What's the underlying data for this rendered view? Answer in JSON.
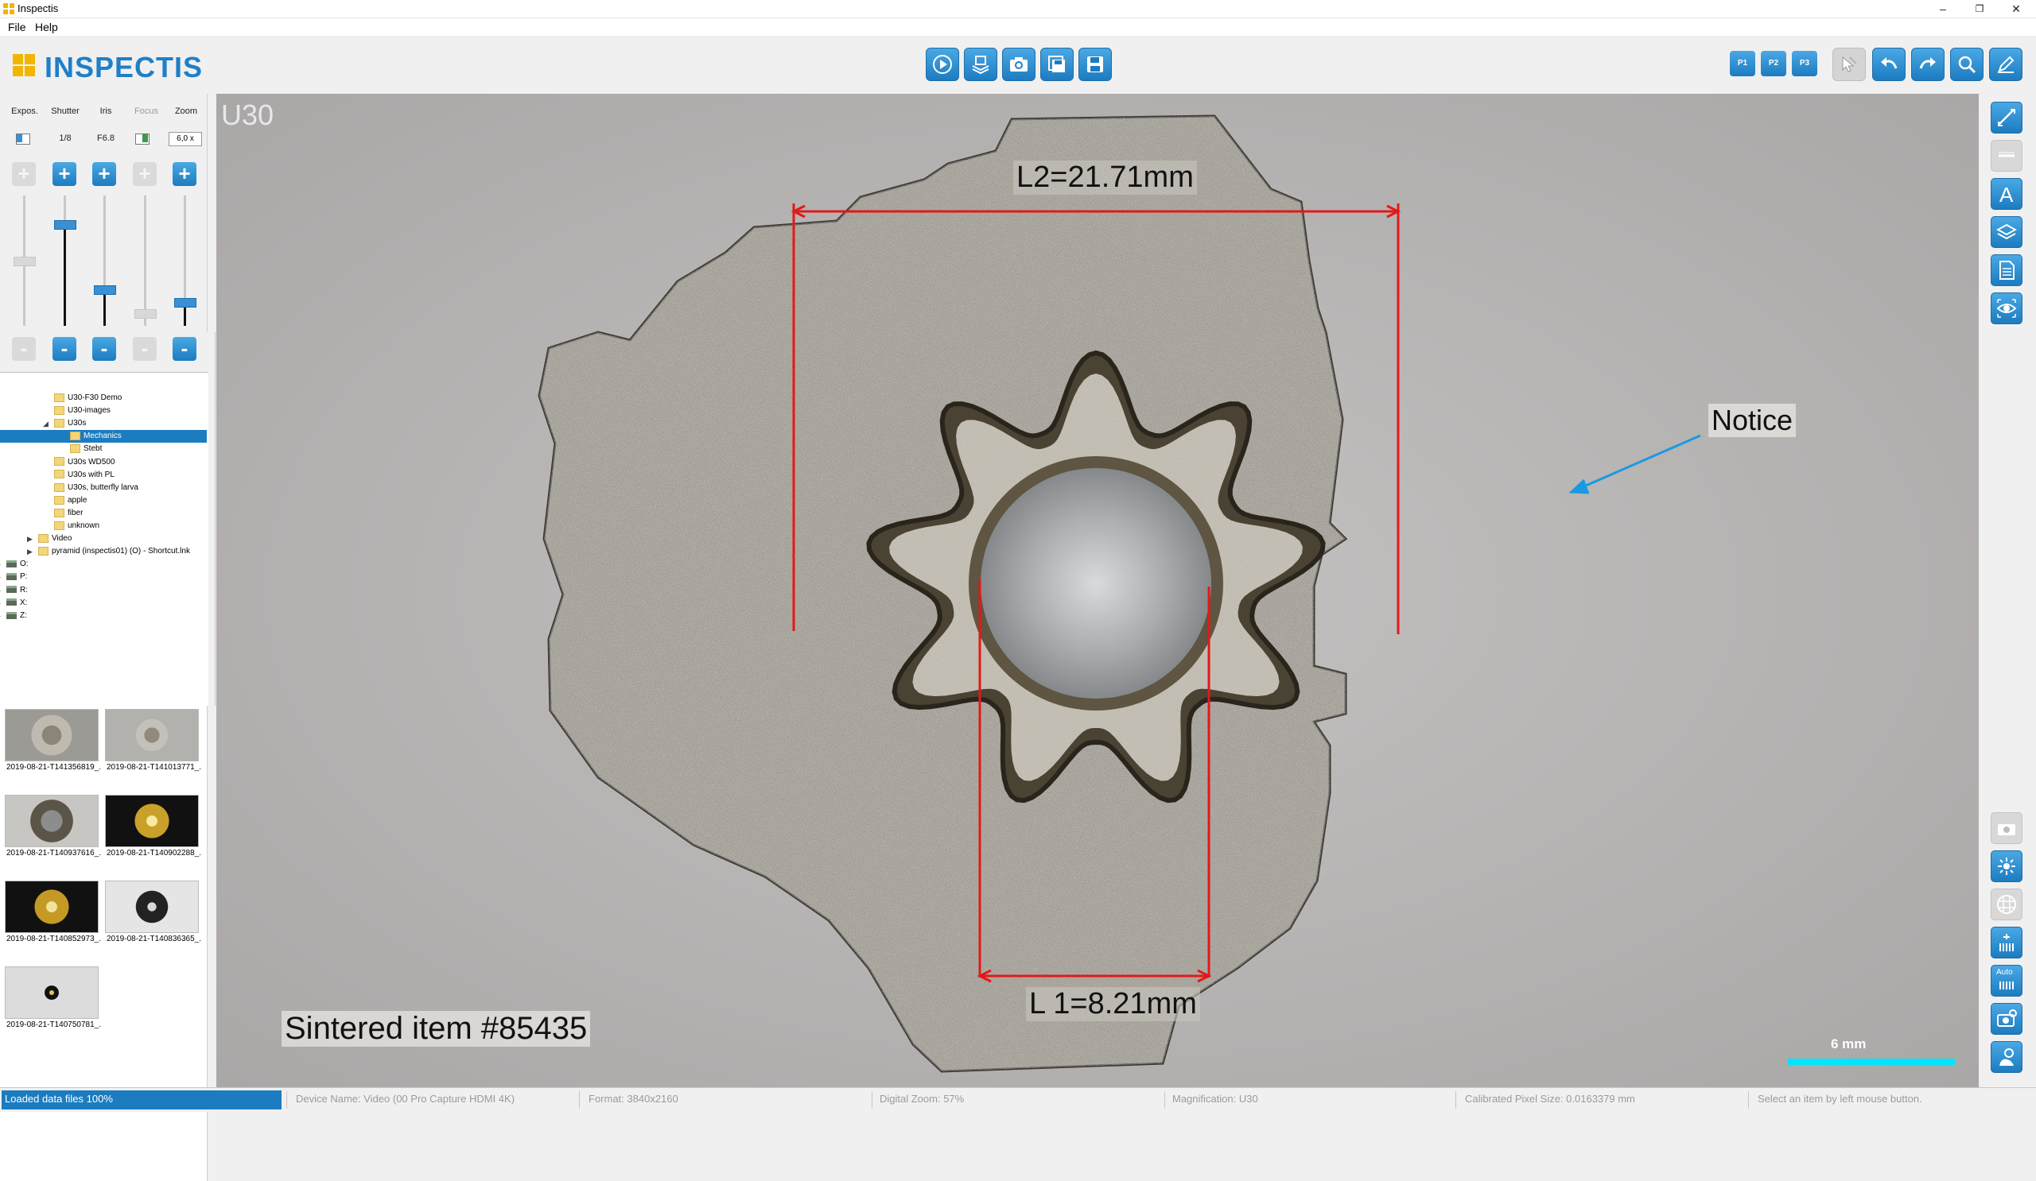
{
  "window": {
    "title": "Inspectis",
    "controls": [
      "–",
      "❐",
      "✕"
    ]
  },
  "menu": [
    "File",
    "Help"
  ],
  "brand": {
    "logo_text": "INSPECTIS",
    "accent": "#1f7fc8",
    "logo_color": "#f2b600"
  },
  "toolbar": {
    "center_buttons": [
      "play-icon",
      "stack-icon",
      "camera-icon",
      "save-stack-icon",
      "save-icon"
    ],
    "presets": [
      "P1",
      "P2",
      "P3"
    ],
    "right_buttons": [
      "select-cursor-icon",
      "undo-icon",
      "redo-icon",
      "zoom-icon",
      "pen-icon"
    ]
  },
  "camera": {
    "labels": [
      "Expos.",
      "Shutter",
      "Iris",
      "Focus",
      "Zoom"
    ],
    "values": [
      "",
      "1/8",
      "F6.8",
      "",
      "6,0 x"
    ],
    "enabled": [
      false,
      true,
      true,
      false,
      true
    ],
    "plus": "+",
    "minus": "-",
    "slider_levels": [
      0.5,
      0.78,
      0.28,
      0.1,
      0.18
    ]
  },
  "tree": [
    {
      "label": "U30-F30 Demo",
      "level": 3
    },
    {
      "label": "U30-images",
      "level": 3
    },
    {
      "label": "U30s",
      "level": 3,
      "expanded": true
    },
    {
      "label": "Mechanics",
      "level": 4,
      "selected": true
    },
    {
      "label": "Stebt",
      "level": 4
    },
    {
      "label": "U30s WD500",
      "level": 3
    },
    {
      "label": "U30s with PL",
      "level": 3
    },
    {
      "label": "U30s, butterfly larva",
      "level": 3
    },
    {
      "label": "apple",
      "level": 3
    },
    {
      "label": "fiber",
      "level": 3
    },
    {
      "label": "unknown",
      "level": 3
    },
    {
      "label": "Video",
      "level": 2
    },
    {
      "label": "pyramid (inspectis01) (O) - Shortcut.lnk",
      "level": 2,
      "type": "link"
    },
    {
      "label": "O:",
      "level": 0,
      "type": "drive"
    },
    {
      "label": "P:",
      "level": 0,
      "type": "drive"
    },
    {
      "label": "R:",
      "level": 0,
      "type": "drive"
    },
    {
      "label": "X:",
      "level": 0,
      "type": "drive"
    },
    {
      "label": "Z:",
      "level": 0,
      "type": "drive"
    }
  ],
  "thumbnails": [
    "2019-08-21-T141356819_...",
    "2019-08-21-T141013771_...",
    "2019-08-21-T140937616_...",
    "2019-08-21-T140902288_...",
    "2019-08-21-T140852973_...",
    "2019-08-21-T140836365_...",
    "2019-08-21-T140750781_..."
  ],
  "viewer": {
    "camera_label": "U30",
    "measure_l2": "L2=21.71mm",
    "measure_l1": "L 1=8.21mm",
    "annotation": "Notice",
    "caption": "Sintered item #85435",
    "scale_label": "6 mm",
    "measure_color": "#e41818",
    "arrow_color": "#1a9ae0",
    "scalebar_color": "#00e5ff"
  },
  "side_tools": [
    "ruler-icon",
    "line-icon",
    "text-icon",
    "layers-icon",
    "document-icon",
    "eye-icon",
    "camera-settings-icon",
    "brightness-icon",
    "grid-icon",
    "white-balance-icon",
    "auto-white-balance-icon",
    "capture-settings-icon",
    "gear-person-icon"
  ],
  "side_auto_label": "Auto",
  "status": {
    "progress_text": "Loaded data files 100%",
    "device": "Device Name: Video (00 Pro Capture HDMI 4K)",
    "format": "Format: 3840x2160",
    "digital_zoom": "Digital Zoom: 57%",
    "magnification": "Magnification: U30",
    "pixel_size": "Calibrated Pixel Size: 0.0163379 mm",
    "hint": "Select an item by left mouse button."
  }
}
